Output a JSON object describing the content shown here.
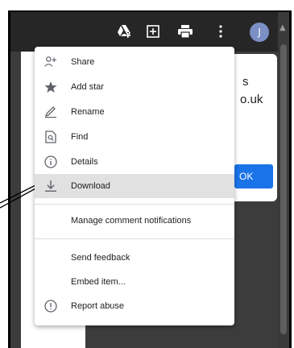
{
  "toolbar": {
    "icons": [
      "drive-add-icon",
      "add-box-icon",
      "print-icon",
      "more-vert-icon"
    ],
    "avatar_letter": "J"
  },
  "panel": {
    "line1": "s",
    "line2": "o.uk",
    "button_label": "OK"
  },
  "menu": {
    "items": [
      {
        "label": "Share",
        "icon": "person-add-icon"
      },
      {
        "label": "Add star",
        "icon": "star-icon"
      },
      {
        "label": "Rename",
        "icon": "pencil-icon"
      },
      {
        "label": "Find",
        "icon": "find-in-page-icon"
      },
      {
        "label": "Details",
        "icon": "info-icon"
      },
      {
        "label": "Download",
        "icon": "download-icon",
        "highlighted": true
      },
      {
        "label": "Manage comment notifications",
        "icon": ""
      },
      {
        "label": "Send feedback",
        "icon": ""
      },
      {
        "label": "Embed item...",
        "icon": ""
      },
      {
        "label": "Report abuse",
        "icon": "report-icon"
      }
    ]
  },
  "colors": {
    "topbar": "#262626",
    "viewer_bg": "#3c3c3c",
    "highlight": "#e1e1e1",
    "accent_blue": "#1a73e8",
    "avatar": "#7a8fc4"
  }
}
